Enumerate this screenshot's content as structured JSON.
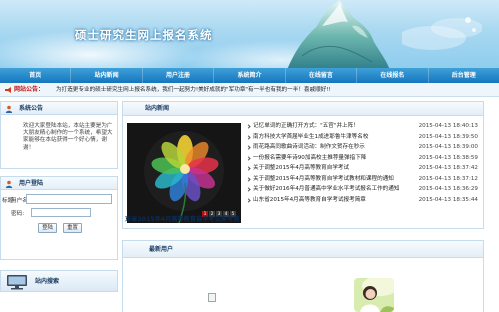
{
  "header": {
    "site_title": "硕士研究生网上报名系统"
  },
  "nav": {
    "items": [
      {
        "label": "首页"
      },
      {
        "label": "站内新闻"
      },
      {
        "label": "用户注册"
      },
      {
        "label": "系统简介"
      },
      {
        "label": "在线留言"
      },
      {
        "label": "在线报名"
      },
      {
        "label": "后台管理"
      }
    ]
  },
  "notice": {
    "label": "网站公告：",
    "text": "为打造更专业的硕士研究生网上报名系统，我们一起努力!美好成就的\"军功章\"有一半也有我的一半！喜戚顺好!!"
  },
  "intro": {
    "title": "系统公告",
    "text": "欢迎大家登陆本站，本站主要是为广大朋友精心制作的一个系统，希望大家能够在本站获得一个好心情，谢谢！"
  },
  "login": {
    "title": "用户登陆",
    "username_label": "用户名:",
    "password_label": "密码:",
    "login_button": "登陆",
    "reset_button": "重置"
  },
  "search": {
    "title": "站内搜索",
    "keyword_label": "标题"
  },
  "news": {
    "title": "站内新闻",
    "slideshow_caption": "东省2015年4月高等教育自学考试报考简",
    "slide_numbers": [
      "1",
      "2",
      "3",
      "4",
      "5"
    ],
    "active_slide": 1,
    "items": [
      {
        "title": "记忆单词的正确打开方式：\"五官\"并上阵！",
        "date": "2015-04-13 18:40:13"
      },
      {
        "title": "南方科技大学首届毕业生1成进耶鲁牛津等名校",
        "date": "2015-04-13 18:39:50"
      },
      {
        "title": "雨花路高同歌曲诗词活动：制作文贺存在秒示",
        "date": "2015-04-13 18:39:00"
      },
      {
        "title": "一份报名需要年诗90加高校主推荐量弹指下降",
        "date": "2015-04-13 18:38:59"
      },
      {
        "title": "关于调整2015年4月高等教育自学考试",
        "date": "2015-04-13 18:37:42"
      },
      {
        "title": "关于调整2015年4月高等教育自学考试教材和课程的通知",
        "date": "2015-04-13 18:37:12"
      },
      {
        "title": "关于做好2016年4月普通高中学业水平考试报名工作的通知",
        "date": "2015-04-13 18:36:29"
      },
      {
        "title": "山东省2015年4月高等教育自学考试报考简章",
        "date": "2015-04-13 18:35:44"
      }
    ]
  },
  "new_users": {
    "title": "最新用户"
  },
  "colors": {
    "nav_blue": "#1576be",
    "notice_red": "#c21717",
    "panel_border": "#c6dbec"
  }
}
